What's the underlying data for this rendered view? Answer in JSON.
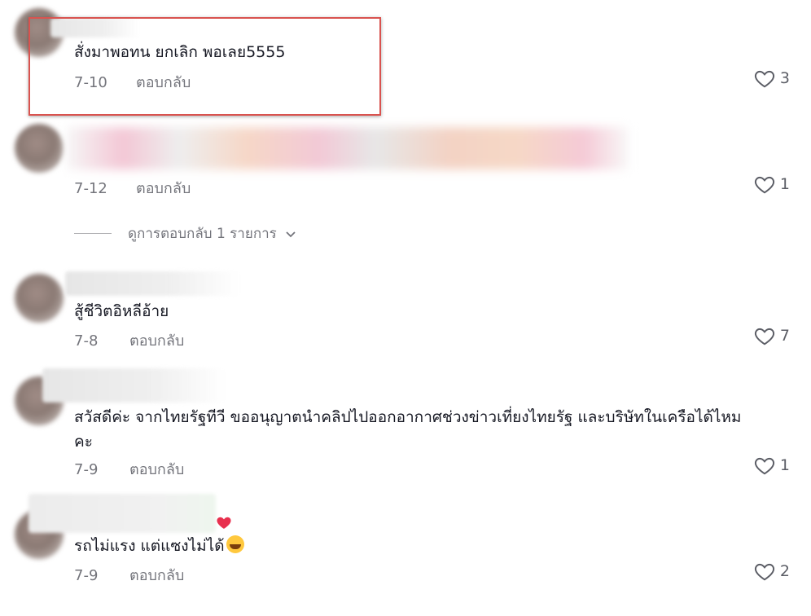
{
  "comments": [
    {
      "text": "สั่งมาพอทน ยกเลิก พอเลย5555",
      "date": "7-10",
      "reply": "ตอบกลับ",
      "likes": "3"
    },
    {
      "text": "",
      "date": "7-12",
      "reply": "ตอบกลับ",
      "likes": "1",
      "view_replies": "ดูการตอบกลับ 1 รายการ"
    },
    {
      "text": "สู้ชีวิตอิหลีอ้าย",
      "date": "7-8",
      "reply": "ตอบกลับ",
      "likes": "7"
    },
    {
      "text_line1": "สวัสดีค่ะ จากไทยรัฐทีวี ขออนุญาตนำคลิปไปออกอากาศช่วงข่าวเที่ยงไทยรัฐ และบริษัทในเครือได้ไหม",
      "text_line2": "คะ",
      "date": "7-9",
      "reply": "ตอบกลับ",
      "likes": "1"
    },
    {
      "text": "รถไม่แรง แต่แซงไม่ได้",
      "date": "7-9",
      "reply": "ตอบกลับ",
      "likes": "2"
    }
  ],
  "colors": {
    "highlight": "#d9534f",
    "text": "#161823",
    "meta": "rgba(22,24,35,0.6)"
  }
}
